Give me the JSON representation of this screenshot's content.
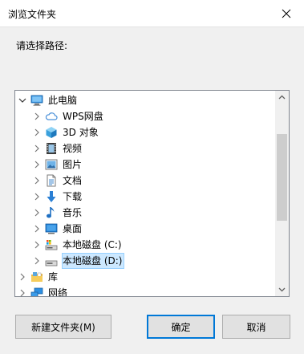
{
  "window": {
    "title": "浏览文件夹"
  },
  "prompt": "请选择路径:",
  "tree": {
    "items": [
      {
        "label": "此电脑",
        "icon": "computer-icon",
        "expanded": true
      },
      {
        "label": "WPS网盘",
        "icon": "cloud-icon"
      },
      {
        "label": "3D 对象",
        "icon": "3d-objects-icon"
      },
      {
        "label": "视频",
        "icon": "video-icon"
      },
      {
        "label": "图片",
        "icon": "pictures-icon"
      },
      {
        "label": "文档",
        "icon": "documents-icon"
      },
      {
        "label": "下载",
        "icon": "download-icon"
      },
      {
        "label": "音乐",
        "icon": "music-icon"
      },
      {
        "label": "桌面",
        "icon": "desktop-icon"
      },
      {
        "label": "本地磁盘 (C:)",
        "icon": "system-drive-icon"
      },
      {
        "label": "本地磁盘 (D:)",
        "icon": "drive-icon",
        "selected": true
      },
      {
        "label": "库",
        "icon": "library-icon"
      },
      {
        "label": "网络",
        "icon": "network-icon"
      }
    ]
  },
  "buttons": {
    "new_folder": "新建文件夹(M)",
    "ok": "确定",
    "cancel": "取消"
  },
  "colors": {
    "selection": "#cce8ff",
    "selection_border": "#99d1ff",
    "default_button_border": "#0078d7"
  }
}
